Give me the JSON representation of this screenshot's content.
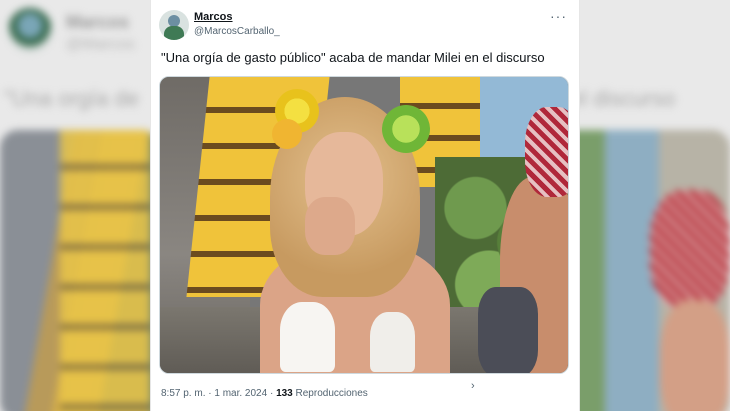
{
  "tweet": {
    "author_name": "Marcos",
    "author_handle": "@MarcosCarballo_",
    "more_menu": "···",
    "text": "\"Una orgía de gasto público\" acaba de mandar Milei en el discurso",
    "time": "8:57 p. m.",
    "separator": " · ",
    "date": "1 mar. 2024",
    "views_count": "133",
    "views_label": " Reproducciones",
    "chevron": "›"
  },
  "background": {
    "name": "Marcos",
    "handle": "@Marcos",
    "text_left": "\"Una orgía de",
    "text_right": "el discurso"
  },
  "icons": {
    "avatar": "user-avatar",
    "more": "more-icon",
    "chevron": "chevron-right-icon"
  },
  "colors": {
    "text_primary": "#0f1419",
    "text_secondary": "#536471",
    "card_bg": "#ffffff"
  }
}
